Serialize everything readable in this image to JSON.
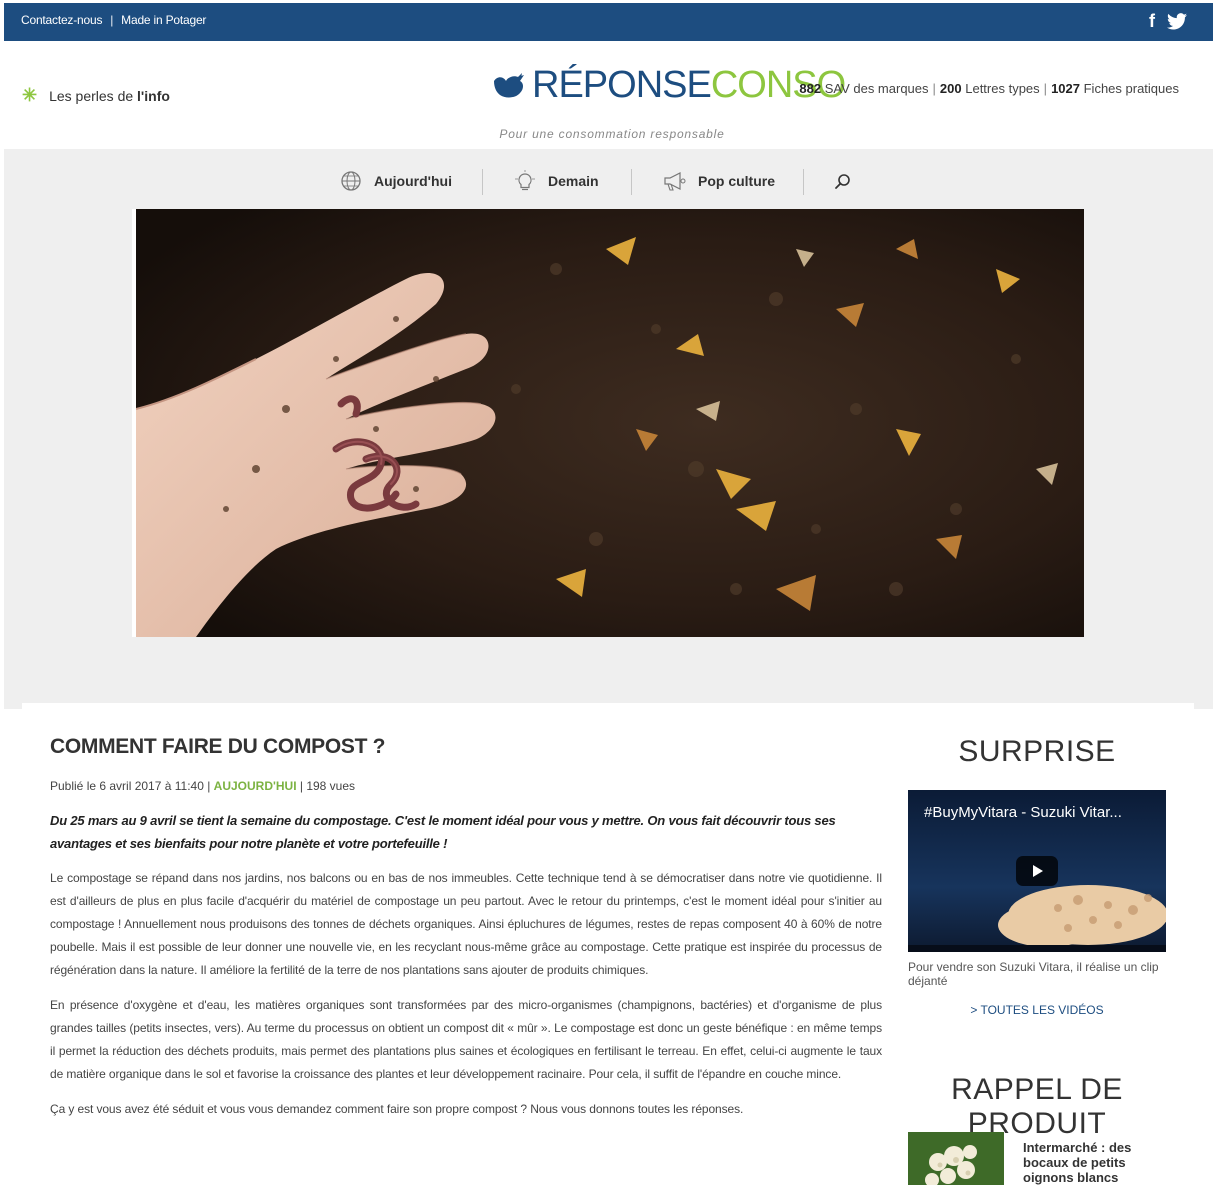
{
  "topbar": {
    "contact_label": "Contactez-nous",
    "separator": "|",
    "made_in_label": "Made in Potager",
    "facebook_glyph": "f",
    "twitter_glyph": "twitter-icon"
  },
  "header": {
    "perles_prefix": "Les perles de ",
    "perles_bold": "l'info",
    "logo_part1": "RÉPONSE",
    "logo_part2": "CONSO",
    "logo_tagline": "Pour une consommation responsable",
    "stats": [
      {
        "value": "882",
        "label": "SAV des marques"
      },
      {
        "value": "200",
        "label": "Lettres types"
      },
      {
        "value": "1027",
        "label": "Fiches pratiques"
      }
    ]
  },
  "nav": {
    "items": [
      {
        "label": "Aujourd'hui",
        "icon": "globe-icon"
      },
      {
        "label": "Demain",
        "icon": "lightbulb-icon"
      },
      {
        "label": "Pop culture",
        "icon": "megaphone-icon"
      }
    ],
    "search_icon": "search-icon"
  },
  "hero": {
    "image": "compost-worms-photo"
  },
  "article": {
    "title": "COMMENT FAIRE DU COMPOST ?",
    "meta_prefix": "Publié le 6 avril 2017 à 11:40 | ",
    "meta_category": "AUJOURD'HUI",
    "meta_suffix": " | 198 vues",
    "lead": "Du 25 mars au 9 avril se tient la semaine du compostage. C'est le moment idéal pour vous y mettre. On vous fait découvrir tous ses avantages et ses bienfaits pour notre planète et votre portefeuille !",
    "paragraphs": [
      "Le compostage se répand dans nos jardins, nos balcons ou en bas de nos immeubles. Cette technique tend à se démocratiser dans notre vie quotidienne. Il est d'ailleurs de plus en plus facile d'acquérir du matériel de compostage un peu partout. Avec le retour du printemps, c'est le moment idéal pour s'initier au compostage ! Annuellement nous produisons des tonnes de déchets organiques. Ainsi épluchures de légumes, restes de repas  composent 40 à 60% de notre poubelle. Mais il est possible de leur donner une nouvelle vie, en les recyclant nous-même grâce au compostage. Cette pratique est inspirée du processus de régénération dans la nature. Il améliore la fertilité de la terre de nos plantations sans ajouter de produits chimiques.",
      "En présence d'oxygène et d'eau, les matières organiques sont transformées par des micro-organismes (champignons, bactéries) et d'organisme de plus grandes tailles (petits insectes, vers). Au terme du processus on obtient un compost dit « mûr ». Le compostage est donc un geste bénéfique : en même temps il permet la réduction des déchets produits, mais permet des plantations plus saines et écologiques en fertilisant le terreau. En effet, celui-ci augmente le taux de matière organique dans le sol et favorise la croissance des plantes et leur développement racinaire. Pour cela, il suffit de l'épandre en couche mince.",
      "Ça y est vous avez été séduit et vous vous demandez comment faire son propre compost ? Nous vous donnons toutes les réponses."
    ]
  },
  "sidebar": {
    "surprise_title": "SURPRISE",
    "video_title": "#BuyMyVitara - Suzuki Vitar...",
    "video_caption": "Pour vendre son Suzuki Vitara, il réalise un clip déjanté",
    "all_videos_label": "> TOUTES LES VIDÉOS",
    "rappel_title": "RAPPEL DE PRODUIT",
    "rappel_item_title": "Intermarché : des bocaux de petits oignons blancs rappelés"
  },
  "colors": {
    "brand_blue": "#1d4d80",
    "brand_green": "#8dc63f",
    "category_green": "#7cb342",
    "background_grey": "#efefef"
  }
}
